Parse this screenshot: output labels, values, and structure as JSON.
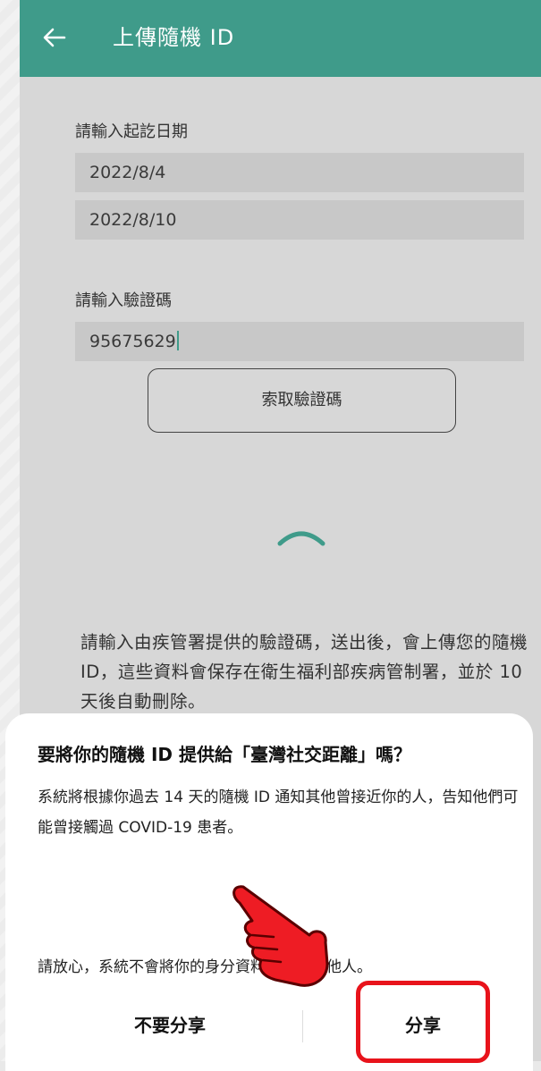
{
  "app_bar": {
    "title": "上傳隨機 ID",
    "back_icon": "arrow-left-icon",
    "color": "#3f9b8a"
  },
  "form": {
    "date_label": "請輸入起訖日期",
    "start_date": "2022/8/4",
    "end_date": "2022/8/10",
    "code_label": "請輸入驗證碼",
    "code_value": "95675629",
    "request_code_button": "索取驗證碼"
  },
  "info_text": "請輸入由疾管署提供的驗證碼，送出後，會上傳您的隨機 ID，這些資料會保存在衛生福利部疾病管制署，並於 10 天後自動刪除。",
  "dialog": {
    "title": "要將你的隨機 ID 提供給「臺灣社交距離」嗎？",
    "body": "系統將根據你過去 14 天的隨機 ID 通知其他曾接近你的人，告知他們可能曾接觸過 COVID-19 患者。",
    "note": "請放心，系統不會將你的身分資料提供給其他人。",
    "decline_button": "不要分享",
    "share_button": "分享"
  },
  "annotation": {
    "highlight_color": "#e8131b",
    "pointer_icon": "pointing-hand-icon"
  }
}
